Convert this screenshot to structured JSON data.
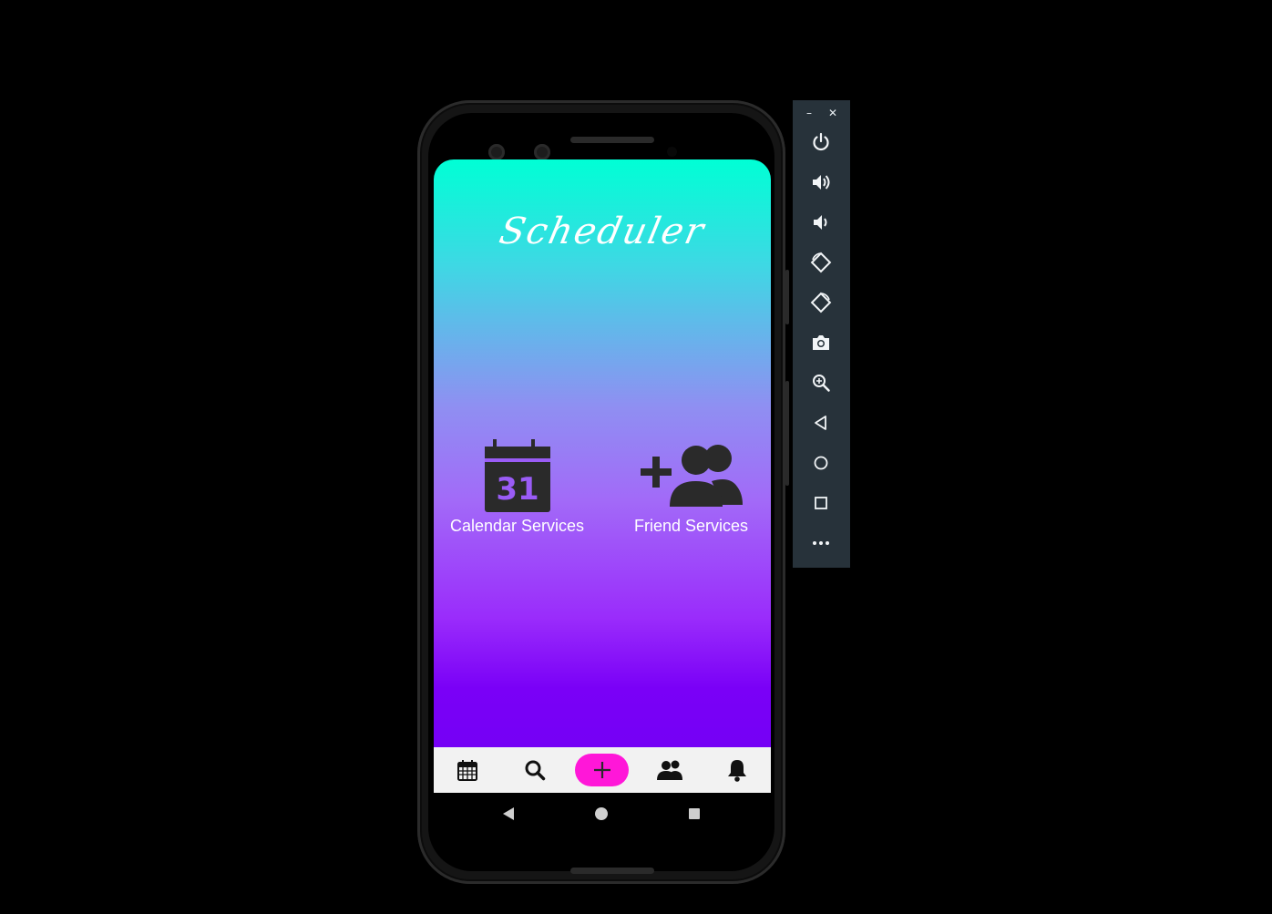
{
  "app": {
    "title": "Scheduler",
    "services": [
      {
        "label": "Calendar Services",
        "icon": "calendar-31-icon"
      },
      {
        "label": "Friend Services",
        "icon": "add-friends-icon"
      }
    ],
    "calendar_day": "31"
  },
  "bottom_nav": {
    "items": [
      {
        "icon": "calendar-icon"
      },
      {
        "icon": "search-icon"
      },
      {
        "icon": "plus-icon"
      },
      {
        "icon": "friends-icon"
      },
      {
        "icon": "bell-icon"
      }
    ],
    "accent": "#ff17d8"
  },
  "system_nav": {
    "items": [
      {
        "icon": "back-triangle-icon"
      },
      {
        "icon": "home-circle-icon"
      },
      {
        "icon": "recents-square-icon"
      }
    ]
  },
  "emulator_toolbar": {
    "minimize_label": "–",
    "close_label": "✕",
    "buttons": [
      {
        "icon": "power-icon"
      },
      {
        "icon": "volume-up-icon"
      },
      {
        "icon": "volume-down-icon"
      },
      {
        "icon": "rotate-left-icon"
      },
      {
        "icon": "rotate-right-icon"
      },
      {
        "icon": "camera-icon"
      },
      {
        "icon": "zoom-icon"
      },
      {
        "icon": "back-icon"
      },
      {
        "icon": "home-icon"
      },
      {
        "icon": "overview-icon"
      },
      {
        "icon": "more-icon"
      }
    ]
  },
  "colors": {
    "gradient_top": "#00ffd5",
    "gradient_bottom": "#7500f5",
    "icon_dark": "#2a2a2a",
    "toolbar_bg": "#27323a"
  }
}
